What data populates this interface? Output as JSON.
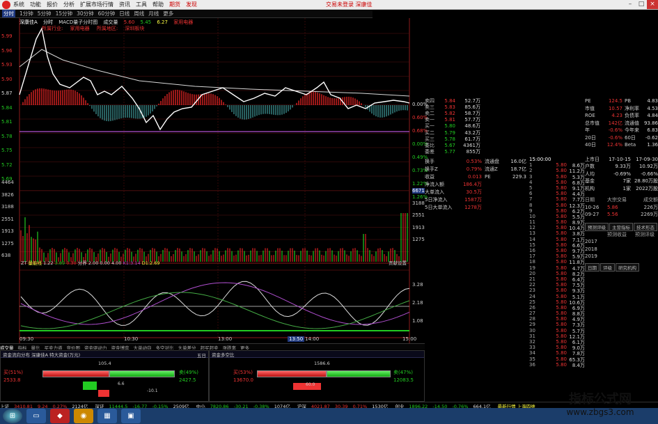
{
  "menu": {
    "items": [
      "系统",
      "功能",
      "报价",
      "分析",
      "扩展市场行情",
      "资讯",
      "工具",
      "帮助",
      "期货",
      "发现"
    ],
    "right_link": "交易未登录",
    "right_link2": "深康佳"
  },
  "periods": [
    "分时",
    "1分钟",
    "5分钟",
    "15分钟",
    "30分钟",
    "60分钟",
    "日线",
    "周线",
    "月线",
    "更多"
  ],
  "chart_info": {
    "name": "深康佳A",
    "period": "分时",
    "indicator": "MACD量子分时图",
    "volume": "成交量",
    "v1": "5.60",
    "v2": "5.45",
    "v3": "6.27",
    "tag": "家用电器"
  },
  "tags": [
    "所属行业:",
    "家用电器",
    "所属地区:",
    "深圳板块"
  ],
  "price_labels": [
    "5.99",
    "5.96",
    "5.93",
    "5.90",
    "5.87",
    "5.84",
    "5.81",
    "5.78",
    "5.75",
    "5.72",
    "5.69"
  ],
  "pct_labels": [
    "0.00%",
    "0.60%",
    "0.68%",
    "0.00%",
    "0.49%",
    "0.73%",
    "1.22%",
    "1.26%"
  ],
  "vol_labels": [
    "4464",
    "3826",
    "3188",
    "2551",
    "1913",
    "1275",
    "638"
  ],
  "right_vol_labels": [
    "6671",
    "3188",
    "2551",
    "1913",
    "1275"
  ],
  "ind_header": {
    "a": "ZT",
    "b": "量能线",
    "c": "1.22",
    "d": "3.89",
    "e": "0.30",
    "f": "分界",
    "g": "2.00",
    "h": "0.00",
    "i": "4.00",
    "j": "K1:3.14",
    "k": "D1:2.69",
    "r": "贡献设置"
  },
  "ind_labels": [
    "3.28",
    "2.18",
    "1.08"
  ],
  "time_labels": [
    "09:30",
    "10:30",
    "13:00",
    "14:00",
    "15:00",
    "13:50"
  ],
  "mid_tabs": [
    "成交量",
    "指标",
    "量比",
    "买卖力道",
    "竞价图",
    "资金驱动力",
    "资金博弈",
    "大单动向",
    "多空对比",
    "大单差分",
    "超买超卖",
    "涨跌率",
    "更多"
  ],
  "left_pane": {
    "title": "资金流向分布",
    "stock": "深康佳A",
    "sub": "特大资金(万元)",
    "pct_top": "105.4",
    "left": "买(51%)",
    "left_val": "2533.8",
    "right": "卖(49%)",
    "right_val": "2427.5",
    "mid": "6.6",
    "mid2": "-10.1",
    "page": "五日"
  },
  "right_pane": {
    "title": "资金多空比",
    "pct_top": "1586.6",
    "left": "买(53%)",
    "left_val": "13670.0",
    "right": "卖(47%)",
    "right_val": "12083.5",
    "mid": "60.0"
  },
  "quote_rows": [
    {
      "l": "卖四",
      "v": "5.84",
      "n": "52.7万"
    },
    {
      "l": "卖三",
      "v": "5.83",
      "n": "85.6万"
    },
    {
      "l": "卖二",
      "v": "5.82",
      "n": "58.7万"
    },
    {
      "l": "卖一",
      "v": "5.81",
      "n": "57.7万"
    },
    {
      "l": "买一",
      "v": "5.80",
      "n": "48.6万"
    },
    {
      "l": "买二",
      "v": "5.79",
      "n": "43.2万"
    },
    {
      "l": "买三",
      "v": "5.78",
      "n": "61.7万"
    },
    {
      "l": "委比",
      "v": "5.67",
      "n": "4361万"
    },
    {
      "l": "委差",
      "v": "5.77",
      "n": "855万"
    }
  ],
  "fin_rows": [
    {
      "a": "换手",
      "b": "0.53%",
      "c": "流通盘",
      "d": "16.0亿"
    },
    {
      "a": "换手Z",
      "b": "0.79%",
      "c": "流通Z",
      "d": "18.7亿"
    },
    {
      "a": "收益",
      "b": "0.013",
      "c": "PE",
      "d": "229.3"
    },
    {
      "a": "净流入额",
      "b": "186.4万",
      "c": "",
      "d": ""
    },
    {
      "a": "大单流入",
      "b": "30.5万",
      "c": "",
      "d": ""
    },
    {
      "a": "5日净流入",
      "b": "1587万",
      "c": "",
      "d": ""
    },
    {
      "a": "5日大单流入",
      "b": "1278万",
      "c": "",
      "d": ""
    }
  ],
  "tick_header": "15:00:00",
  "ticks_price": "5.80",
  "ticks_vols": [
    "8.6万",
    "11.2万",
    "5.3万",
    "6.8万",
    "9.1万",
    "4.4万",
    "7.7万",
    "12.3万",
    "6.2万",
    "5.5万",
    "8.9万",
    "10.4万",
    "3.8万",
    "7.1万",
    "6.6万",
    "9.7万",
    "5.9万",
    "11.8万",
    "4.7万",
    "8.2万",
    "6.4万",
    "7.5万",
    "9.3万",
    "5.1万",
    "10.6万",
    "6.9万",
    "8.8万",
    "4.9万",
    "7.3万",
    "5.7万",
    "12.1万",
    "6.1万",
    "9.0万",
    "7.8万",
    "65.3万",
    "8.4万"
  ],
  "far_right": [
    {
      "a": "PE",
      "b": "124.5",
      "c": "PB",
      "d": "4.83"
    },
    {
      "a": "市值",
      "b": "10.57",
      "c": "净利率",
      "d": "4.53"
    },
    {
      "a": "ROE",
      "b": "4.23",
      "c": "负债率",
      "d": "4.84"
    },
    {
      "a": "总市值",
      "b": "142亿",
      "c": "流通值",
      "d": "93.86"
    },
    {
      "a": "年",
      "b": "-0.6%",
      "c": "今年来",
      "d": "6.83"
    },
    {
      "a": "20日",
      "b": "-0.6%",
      "c": "60日",
      "d": "-0.62"
    },
    {
      "a": "40日",
      "b": "12.4%",
      "c": "Beta",
      "d": "1.36"
    }
  ],
  "far_right2": [
    {
      "a": "上市日",
      "b": "17-10-15",
      "c": "17-09-30"
    },
    {
      "a": "户数",
      "b": "9.33万",
      "c": "10.92万"
    },
    {
      "a": "人均",
      "b": "-0.69%",
      "c": "-0.66%"
    },
    {
      "a": "基金",
      "b": "7家",
      "c": "28.80万股"
    },
    {
      "a": "机构",
      "b": "1家",
      "c": "2022万股"
    }
  ],
  "block_trade": {
    "head": [
      "日期",
      "大宗交易",
      "成交额"
    ],
    "rows": [
      [
        "10-26",
        "5.86",
        "226万"
      ],
      [
        "09-27",
        "5.56",
        "2269万"
      ]
    ]
  },
  "bottom_tabs": [
    "预测评级",
    "主营指标",
    "技术形态"
  ],
  "forecast": {
    "head": [
      "预测收益",
      "预测评级"
    ],
    "years": [
      "2017",
      "2018",
      "2019"
    ]
  },
  "rating_tabs": [
    "日期",
    "评级",
    "研究机构"
  ],
  "status": [
    {
      "t": "上证",
      "v": "3410.81",
      "c": "9.24",
      "p": "0.27%",
      "a": "2124亿"
    },
    {
      "t": "深证",
      "v": "11444.5",
      "c": "-16.77",
      "p": "-0.15%",
      "a": "2509亿"
    },
    {
      "t": "中小",
      "v": "7820.86",
      "c": "-30.21",
      "p": "-0.38%",
      "a": "1074亿"
    },
    {
      "t": "沪深",
      "v": "4021.87",
      "c": "30.39",
      "p": "0.71%",
      "a": "1530亿"
    },
    {
      "t": "创业",
      "v": "1896.22",
      "c": "-14.50",
      "p": "-0.76%",
      "a": "664.1亿"
    }
  ],
  "status_tail": "最新行情 上海四维",
  "watermark": {
    "line1": "指标公式网",
    "line2": "www.zbgs3.com"
  },
  "colors": {
    "up": "#e33",
    "down": "#2c2",
    "bg": "#000",
    "accent": "#ff4"
  }
}
